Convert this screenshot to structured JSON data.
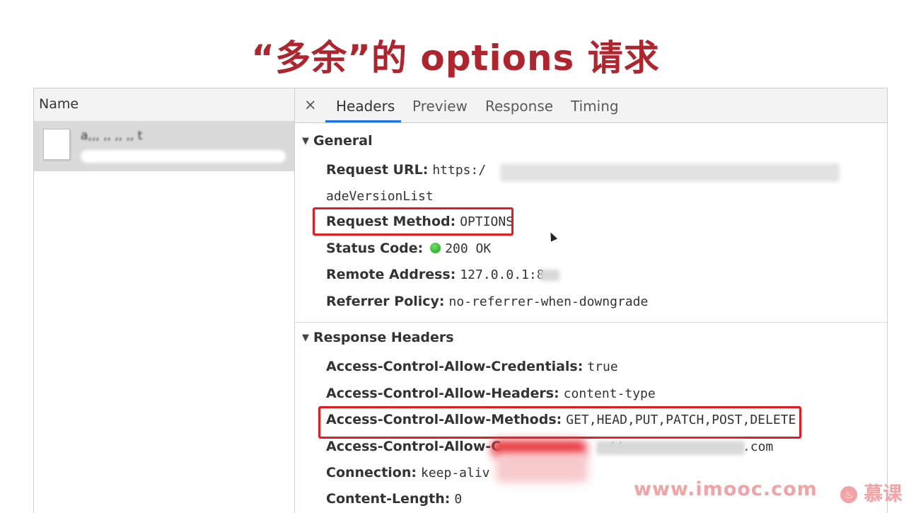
{
  "title": "“多余”的 options 请求",
  "name_panel": {
    "header": "Name",
    "request": {
      "name": "a,,, ,, ,, ,, t"
    }
  },
  "tabs": {
    "close": "×",
    "items": [
      "Headers",
      "Preview",
      "Response",
      "Timing"
    ],
    "active": "Headers"
  },
  "general": {
    "title": "General",
    "rows": [
      {
        "key": "Request URL:",
        "value": "https:/"
      },
      {
        "key": "",
        "value": "adeVersionList"
      },
      {
        "key": "Request Method:",
        "value": "OPTIONS"
      },
      {
        "key": "Status Code:",
        "value": "200 OK"
      },
      {
        "key": "Remote Address:",
        "value": "127.0.0.1:8"
      },
      {
        "key": "Referrer Policy:",
        "value": "no-referrer-when-downgrade"
      }
    ]
  },
  "response_headers": {
    "title": "Response Headers",
    "rows": [
      {
        "key": "Access-Control-Allow-Credentials:",
        "value": "true"
      },
      {
        "key": "Access-Control-Allow-Headers:",
        "value": "content-type"
      },
      {
        "key": "Access-Control-Allow-Methods:",
        "value": "GET,HEAD,PUT,PATCH,POST,DELETE"
      },
      {
        "key": "Access-Control-Allow-C",
        "value": "//",
        "suffix": ".com"
      },
      {
        "key": "Connection:",
        "value": "keep-aliv"
      },
      {
        "key": "Content-Length:",
        "value": "0"
      }
    ]
  },
  "status_color": "#13a313",
  "highlight_color": "#e31b23",
  "watermark": {
    "site": "www.imooc.com",
    "brand": "慕课"
  }
}
